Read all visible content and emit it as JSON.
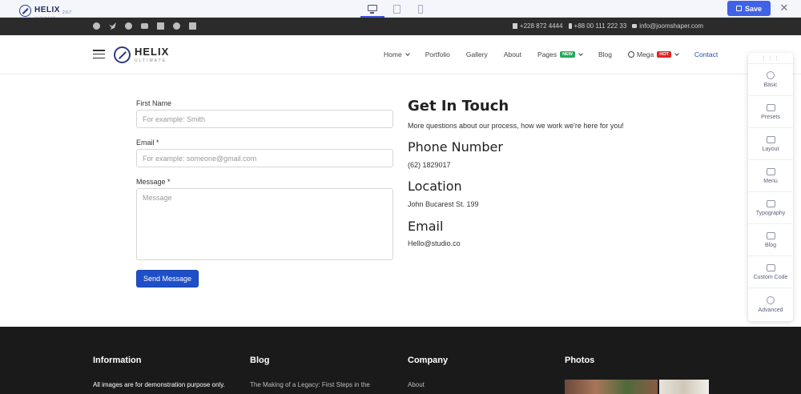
{
  "builder": {
    "logo_text": "HELIX",
    "logo_subtext": "ULTIMATE",
    "version": "2.0.7",
    "save_label": "Save",
    "close_label": "✕"
  },
  "topbar": {
    "phone": "+228 872 4444",
    "mobile": "+88 00 111 222 33",
    "email": "info@joomshaper.com"
  },
  "header": {
    "logo_text": "HELIX",
    "logo_subtext": "ULTIMATE",
    "nav": {
      "home": "Home",
      "portfolio": "Portfolio",
      "gallery": "Gallery",
      "about": "About",
      "pages": "Pages",
      "pages_badge": "NEW",
      "blog": "Blog",
      "mega": "Mega",
      "mega_badge": "HOT",
      "contact": "Contact"
    }
  },
  "form": {
    "first_name_label": "First Name",
    "first_name_placeholder": "For example: Smith",
    "email_label": "Email *",
    "email_placeholder": "For example: someone@gmail.com",
    "message_label": "Message *",
    "message_placeholder": "Message",
    "submit_label": "Send Message"
  },
  "info": {
    "title": "Get In Touch",
    "intro": "More questions about our process, how we work we're here for you!",
    "phone_heading": "Phone Number",
    "phone_value": "(62) 1829017",
    "location_heading": "Location",
    "location_value": "John Bucarest St. 199",
    "email_heading": "Email",
    "email_value": "Hello@studio.co"
  },
  "panel": {
    "items": [
      "Basic",
      "Presets",
      "Layout",
      "Menu",
      "Typography",
      "Blog",
      "Custom Code",
      "Advanced"
    ]
  },
  "footer": {
    "information_heading": "Information",
    "information_text": "All images are for demonstration purpose only.",
    "blog_heading": "Blog",
    "blog_text": "The Making of a Legacy: First Steps in the",
    "company_heading": "Company",
    "company_text": "About",
    "photos_heading": "Photos"
  }
}
